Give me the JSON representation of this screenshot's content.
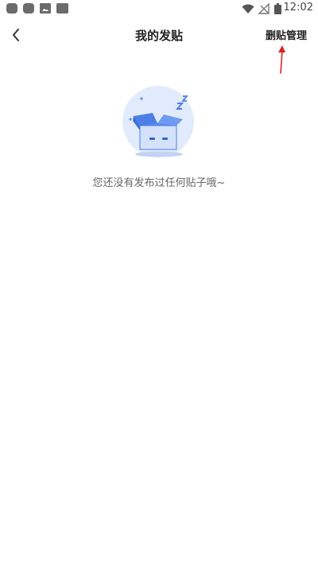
{
  "status_bar": {
    "time": "12:02",
    "left_icons": [
      "notification-icon",
      "notification-icon",
      "image-icon",
      "app-icon"
    ],
    "right_icons": [
      "wifi-icon",
      "no-signal-icon",
      "battery-icon"
    ]
  },
  "header": {
    "title": "我的发贴",
    "back_icon": "chevron-left-icon",
    "manage_label": "删贴管理"
  },
  "empty_state": {
    "illustration": "sleeping-box-illustration",
    "message": "您还没有发布过任何贴子哦~"
  },
  "annotation": {
    "arrow_color": "#e02020"
  },
  "colors": {
    "background": "#ffffff",
    "illustration_blue": "#5b8ef0",
    "illustration_light": "#dbe6fb"
  }
}
